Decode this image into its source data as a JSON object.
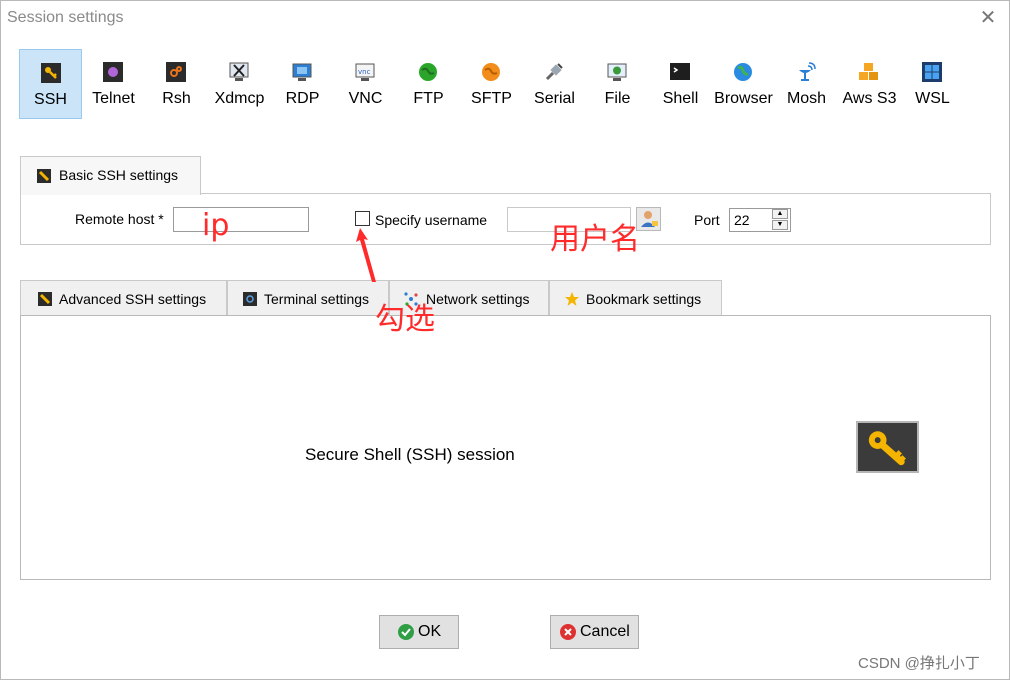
{
  "window": {
    "title": "Session settings",
    "close_label": "✕"
  },
  "session_types": [
    {
      "label": "SSH",
      "icon": "ssh-key-icon",
      "active": true
    },
    {
      "label": "Telnet",
      "icon": "telnet-icon"
    },
    {
      "label": "Rsh",
      "icon": "rsh-icon"
    },
    {
      "label": "Xdmcp",
      "icon": "xdmcp-icon"
    },
    {
      "label": "RDP",
      "icon": "rdp-monitor-icon"
    },
    {
      "label": "VNC",
      "icon": "vnc-icon"
    },
    {
      "label": "FTP",
      "icon": "ftp-globe-icon"
    },
    {
      "label": "SFTP",
      "icon": "sftp-icon"
    },
    {
      "label": "Serial",
      "icon": "serial-plug-icon"
    },
    {
      "label": "File",
      "icon": "file-monitor-icon"
    },
    {
      "label": "Shell",
      "icon": "terminal-icon"
    },
    {
      "label": "Browser",
      "icon": "browser-globe-icon"
    },
    {
      "label": "Mosh",
      "icon": "mosh-satellite-icon"
    },
    {
      "label": "Aws S3",
      "icon": "aws-cubes-icon"
    },
    {
      "label": "WSL",
      "icon": "windows-logo-icon"
    }
  ],
  "basic": {
    "tab_label": "Basic SSH settings",
    "remote_host_label": "Remote host *",
    "remote_host_value": "",
    "specify_username_label": "Specify username",
    "specify_username_checked": false,
    "username_value": "",
    "port_label": "Port",
    "port_value": "22"
  },
  "lower_tabs": [
    {
      "label": "Advanced SSH settings",
      "icon": "wrench-icon"
    },
    {
      "label": "Terminal settings",
      "icon": "terminal-settings-icon"
    },
    {
      "label": "Network settings",
      "icon": "network-icon"
    },
    {
      "label": "Bookmark settings",
      "icon": "star-icon"
    }
  ],
  "panel": {
    "description": "Secure Shell (SSH) session"
  },
  "buttons": {
    "ok": "OK",
    "cancel": "Cancel"
  },
  "annotations": {
    "ip": "ip",
    "check": "勾选",
    "username": "用户名"
  },
  "watermark": "CSDN @挣扎小丁",
  "colors": {
    "active_tab": "#cce4f7",
    "annotation": "#ff2a2a"
  }
}
